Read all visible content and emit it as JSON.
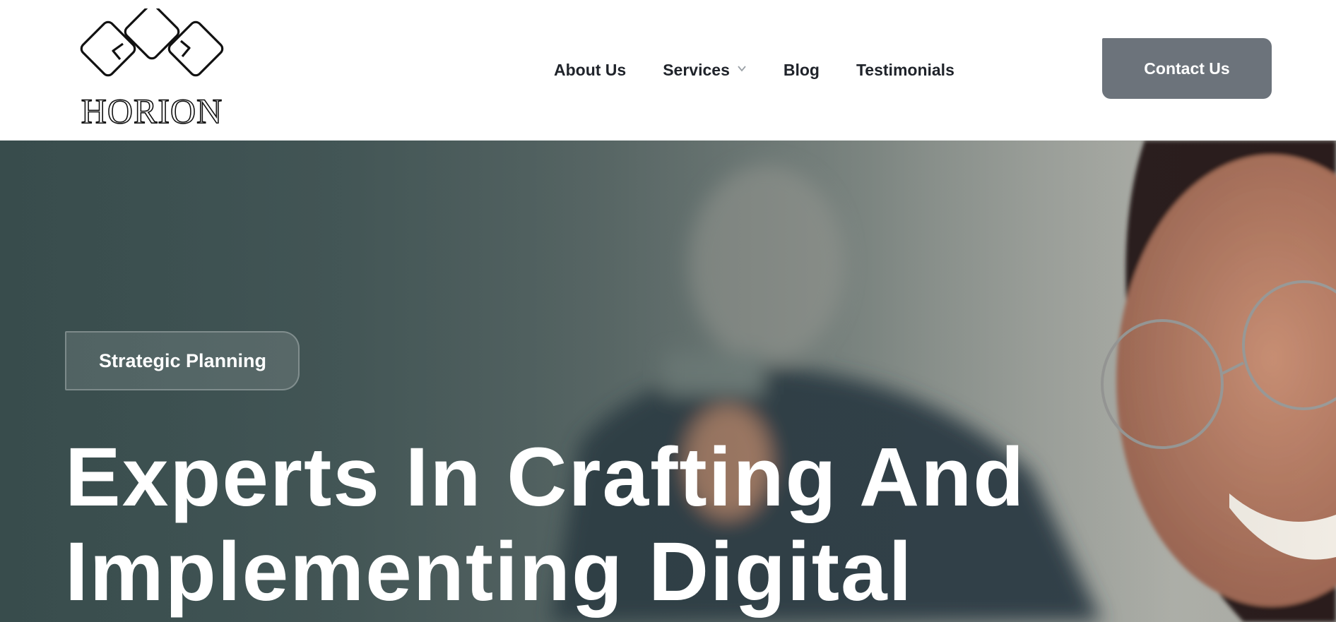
{
  "brand": {
    "name": "HORION"
  },
  "nav": {
    "items": [
      {
        "label": "About Us"
      },
      {
        "label": "Services",
        "has_dropdown": true
      },
      {
        "label": "Blog"
      },
      {
        "label": "Testimonials"
      }
    ]
  },
  "header": {
    "contact_label": "Contact Us"
  },
  "hero": {
    "badge": "Strategic Planning",
    "headline_line1": "Experts In Crafting And",
    "headline_line2": "Implementing Digital"
  },
  "colors": {
    "contact_button": "#6c737b",
    "nav_text": "#1f232a",
    "hero_text": "#ffffff"
  }
}
